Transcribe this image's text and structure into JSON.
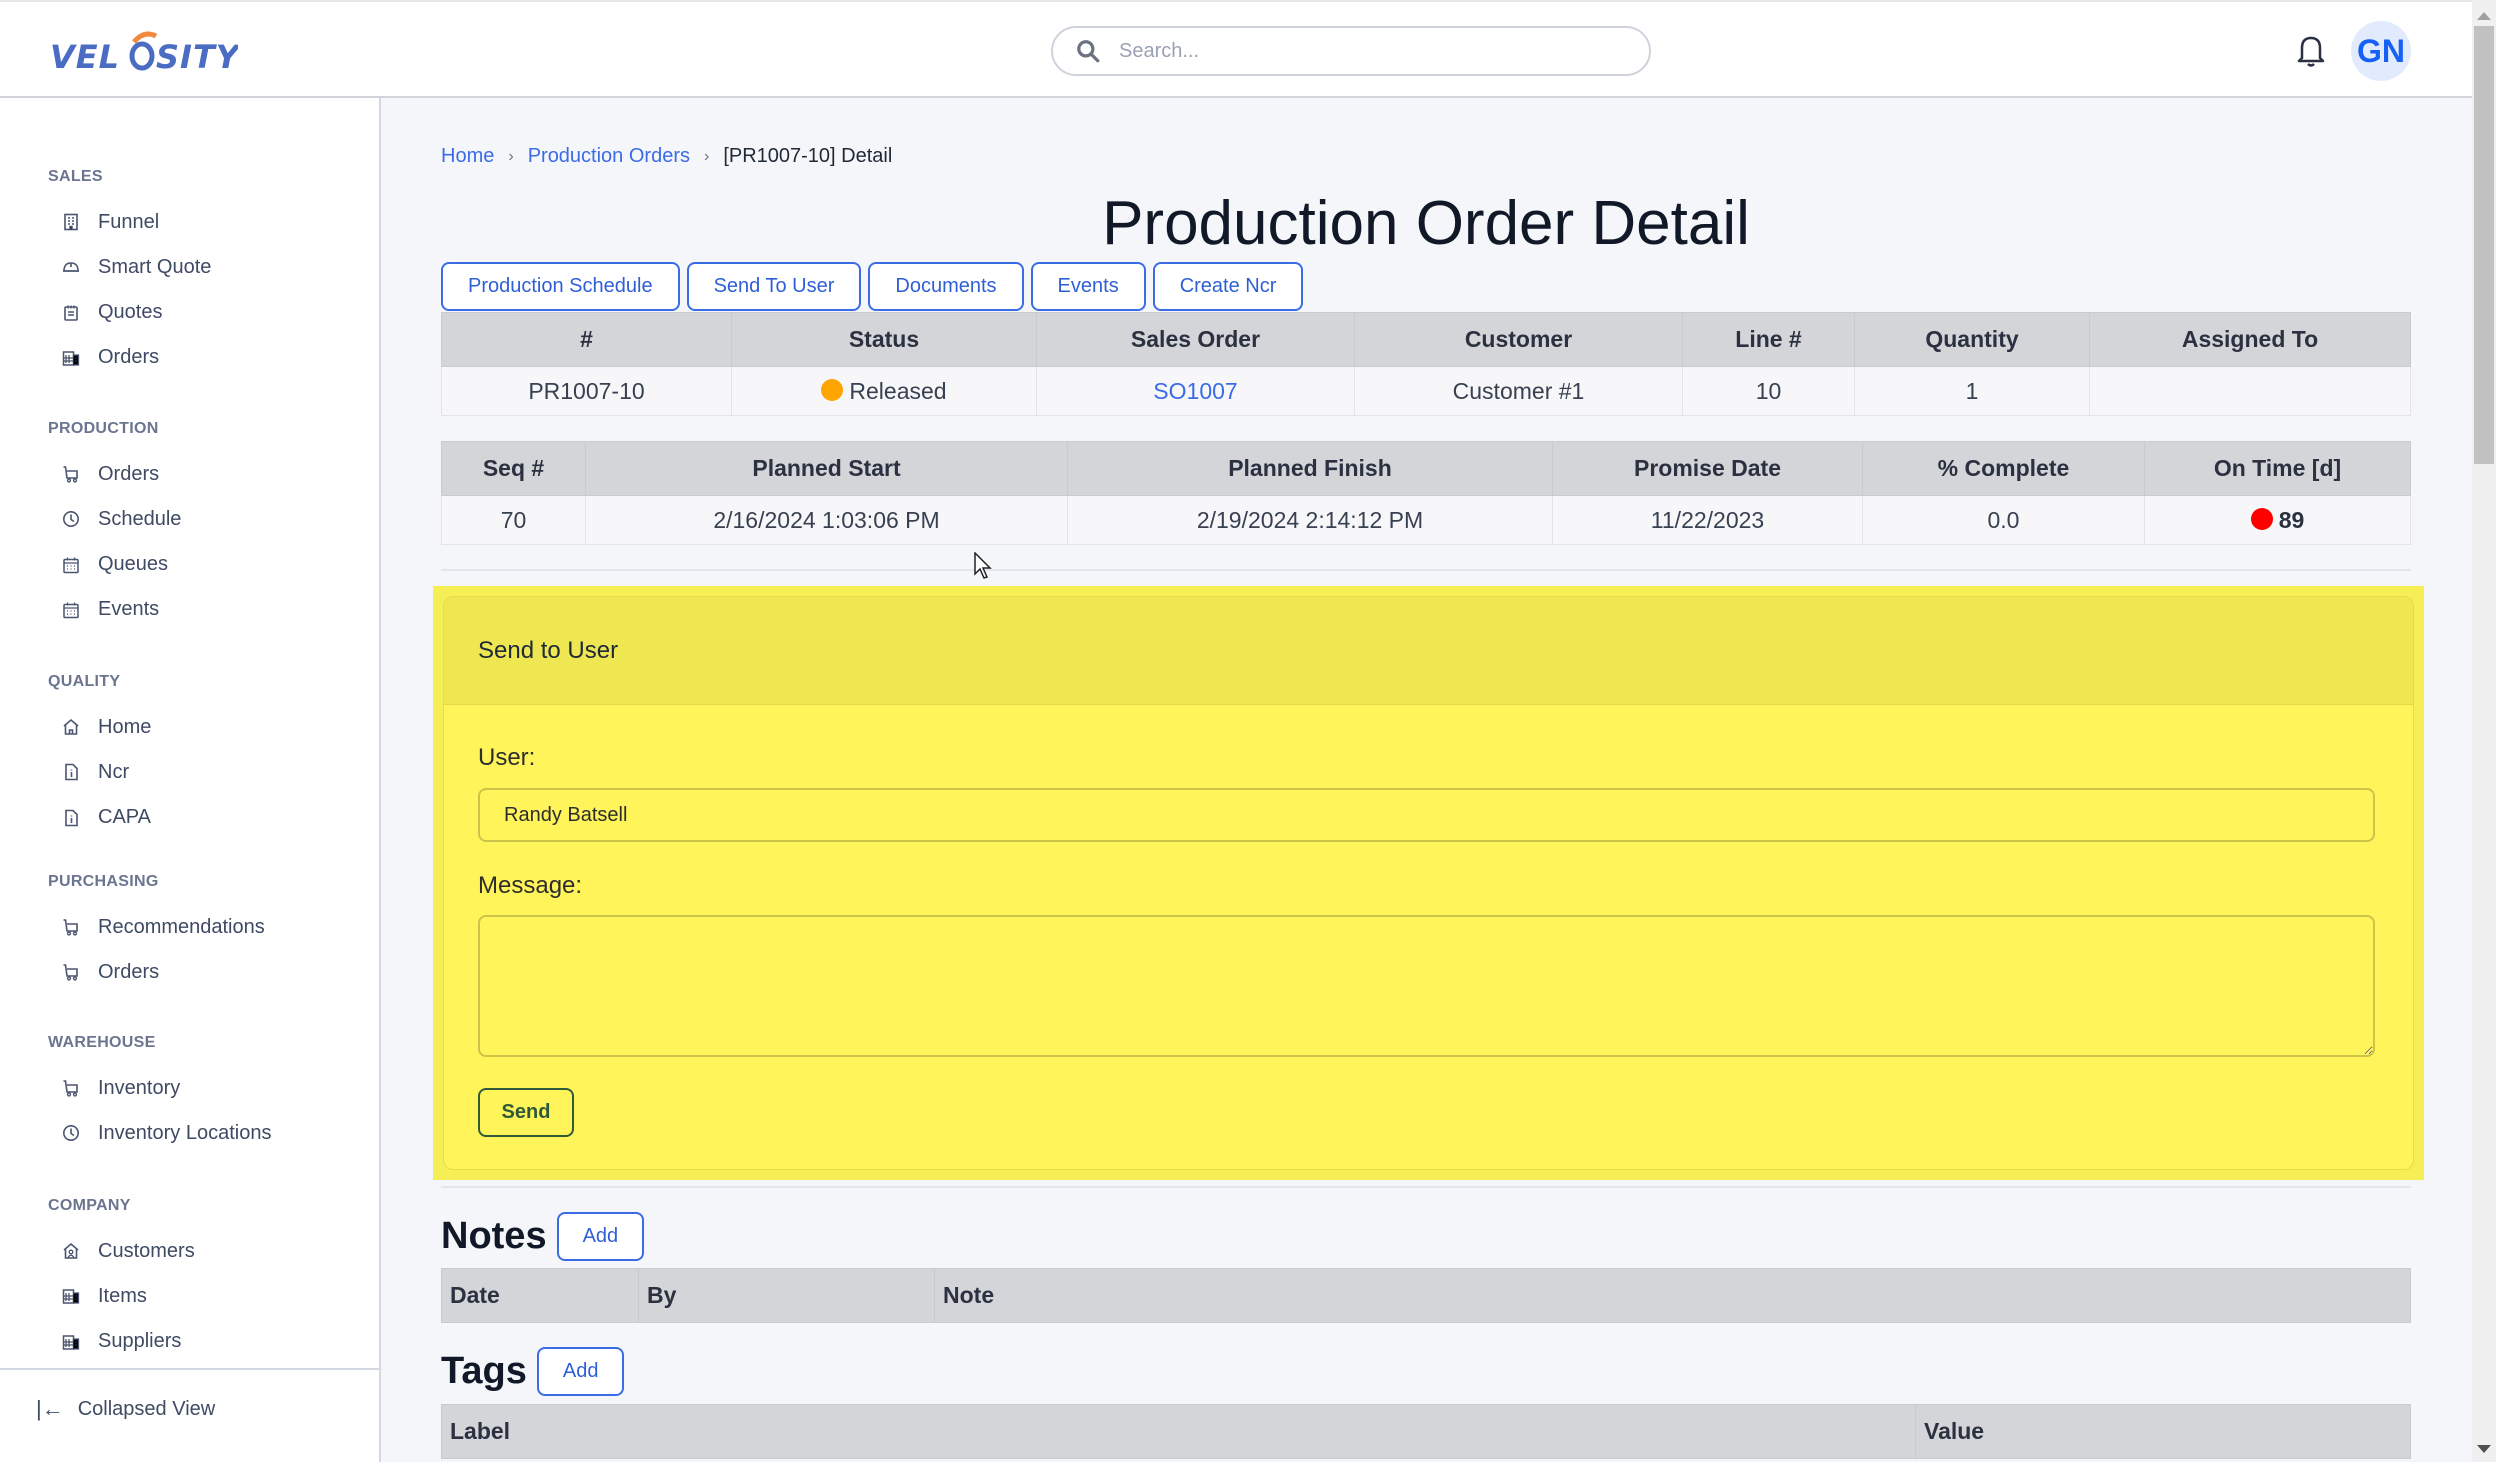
{
  "header": {
    "logo_text": "VELOSITY",
    "search_placeholder": "Search...",
    "avatar_initials": "GN",
    "icons": {
      "search": "search-icon",
      "notifications": "bell-icon"
    }
  },
  "colors": {
    "accent": "#3b6ce6",
    "avatar_text": "#1560f5",
    "avatar_bg": "#e2ebfd",
    "panel_yellow": "#fff45a",
    "status_released": "#ffa500",
    "on_time_late": "#ff0000"
  },
  "sidebar": {
    "sections": [
      {
        "title": "SALES",
        "items": [
          {
            "label": "Funnel",
            "icon": "building-icon"
          },
          {
            "label": "Smart Quote",
            "icon": "helmet-icon"
          },
          {
            "label": "Quotes",
            "icon": "notepad-icon"
          },
          {
            "label": "Orders",
            "icon": "buildings-icon"
          }
        ]
      },
      {
        "title": "PRODUCTION",
        "items": [
          {
            "label": "Orders",
            "icon": "cart-icon"
          },
          {
            "label": "Schedule",
            "icon": "clock-icon"
          },
          {
            "label": "Queues",
            "icon": "calendar-icon"
          },
          {
            "label": "Events",
            "icon": "calendar-icon"
          }
        ]
      },
      {
        "title": "QUALITY",
        "items": [
          {
            "label": "Home",
            "icon": "home-icon"
          },
          {
            "label": "Ncr",
            "icon": "file-info-icon"
          },
          {
            "label": "CAPA",
            "icon": "file-info-icon"
          }
        ]
      },
      {
        "title": "PURCHASING",
        "items": [
          {
            "label": "Recommendations",
            "icon": "cart-icon"
          },
          {
            "label": "Orders",
            "icon": "cart-icon"
          }
        ]
      },
      {
        "title": "WAREHOUSE",
        "items": [
          {
            "label": "Inventory",
            "icon": "cart-icon"
          },
          {
            "label": "Inventory Locations",
            "icon": "clock-icon"
          }
        ]
      },
      {
        "title": "COMPANY",
        "items": [
          {
            "label": "Customers",
            "icon": "home-user-icon"
          },
          {
            "label": "Items",
            "icon": "buildings-icon"
          },
          {
            "label": "Suppliers",
            "icon": "buildings-icon"
          }
        ]
      }
    ],
    "collapse_label": "Collapsed View"
  },
  "breadcrumb": {
    "items": [
      "Home",
      "Production Orders"
    ],
    "current": "[PR1007-10] Detail"
  },
  "page": {
    "title": "Production Order Detail",
    "actions": [
      "Production Schedule",
      "Send To User",
      "Documents",
      "Events",
      "Create Ncr"
    ]
  },
  "order_table": {
    "headers": [
      "#",
      "Status",
      "Sales Order",
      "Customer",
      "Line #",
      "Quantity",
      "Assigned To"
    ],
    "row": {
      "number": "PR1007-10",
      "status": "Released",
      "sales_order": "SO1007",
      "customer": "Customer #1",
      "line": "10",
      "quantity": "1",
      "assigned_to": ""
    }
  },
  "schedule_table": {
    "headers": [
      "Seq #",
      "Planned Start",
      "Planned Finish",
      "Promise Date",
      "% Complete",
      "On Time [d]"
    ],
    "row": {
      "seq": "70",
      "planned_start": "2/16/2024 1:03:06 PM",
      "planned_finish": "2/19/2024 2:14:12 PM",
      "promise_date": "11/22/2023",
      "percent_complete": "0.0",
      "on_time": "89"
    }
  },
  "send_panel": {
    "title": "Send to User",
    "user_label": "User:",
    "user_value": "Randy Batsell",
    "message_label": "Message:",
    "message_value": "",
    "send_label": "Send"
  },
  "notes": {
    "title": "Notes",
    "add_label": "Add",
    "headers": [
      "Date",
      "By",
      "Note"
    ]
  },
  "tags": {
    "title": "Tags",
    "add_label": "Add",
    "headers": [
      "Label",
      "Value"
    ]
  }
}
